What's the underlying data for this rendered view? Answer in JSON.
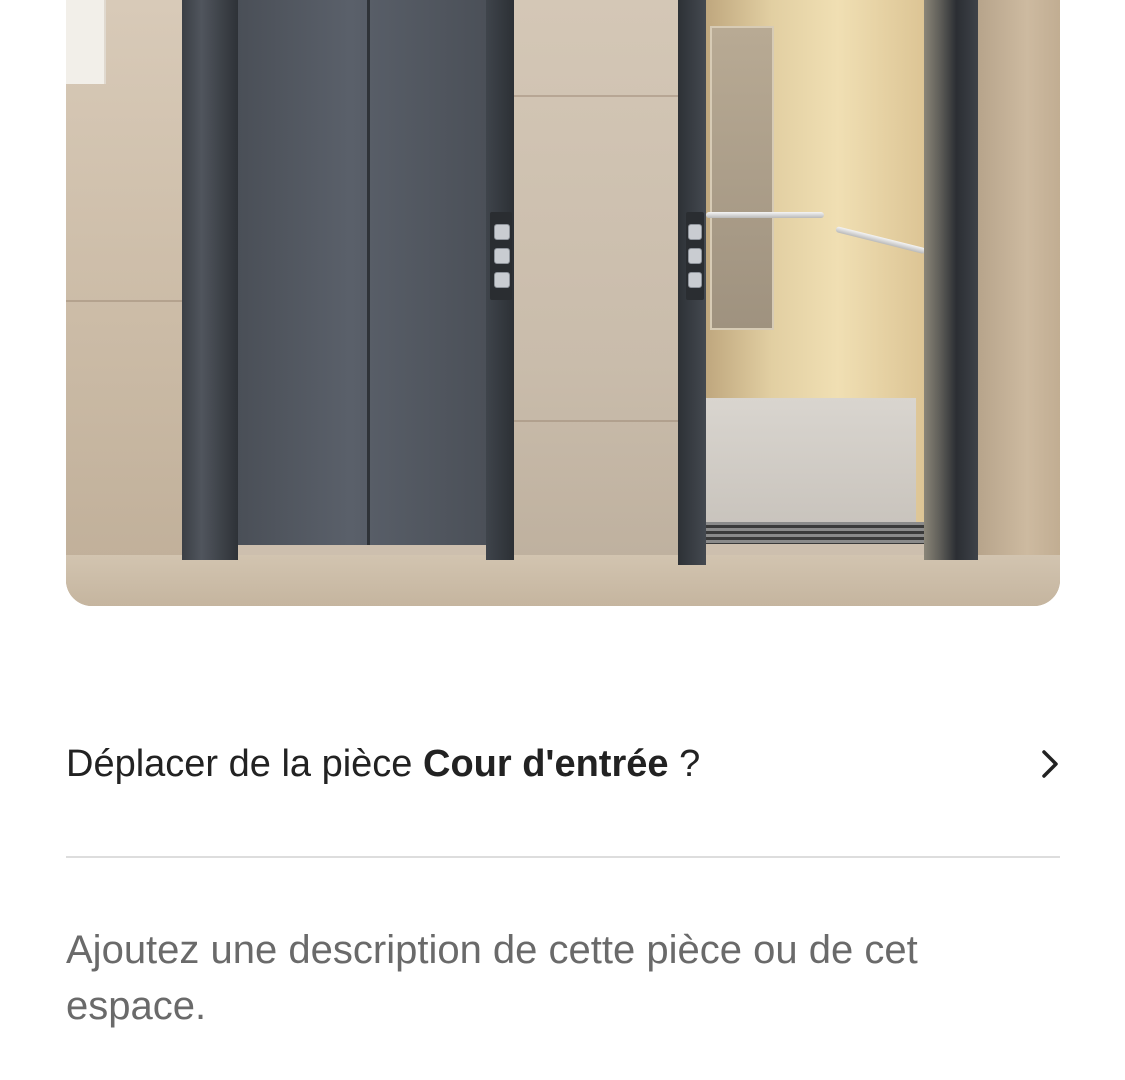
{
  "photo": {
    "subject": "elevator-entrance-photo"
  },
  "move_row": {
    "prefix": "Déplacer de la pièce ",
    "room": "Cour d'entrée",
    "suffix": " ?",
    "icon": "chevron-right-icon"
  },
  "description": {
    "placeholder": "Ajoutez une description de cette pièce ou de cet espace."
  },
  "colors": {
    "text": "#222222",
    "secondary_text": "#6a6a6a",
    "divider": "#dddddd"
  }
}
